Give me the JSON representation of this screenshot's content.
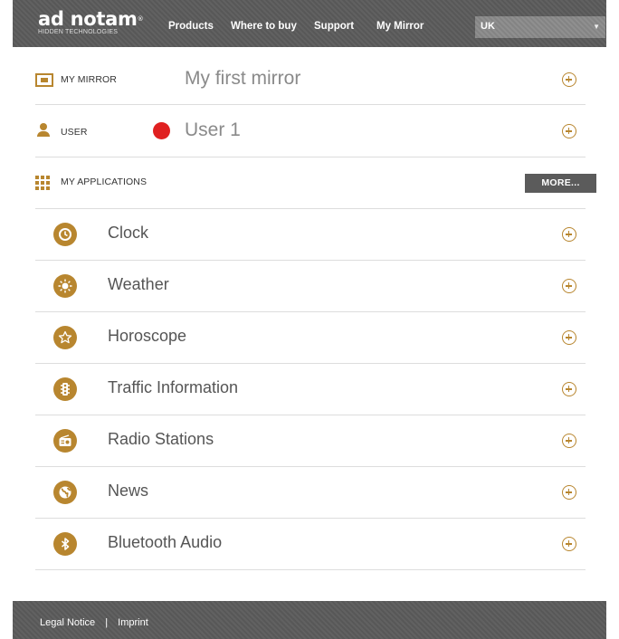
{
  "brand": {
    "name": "ad notam",
    "tagline": "HIDDEN TECHNOLOGIES",
    "mark": "®"
  },
  "nav": {
    "products": "Products",
    "where_to_buy": "Where to buy",
    "support": "Support",
    "my_mirror": "My Mirror"
  },
  "country": {
    "selected": "UK"
  },
  "mirror": {
    "label": "MY MIRROR",
    "value": "My first mirror"
  },
  "user": {
    "label": "USER",
    "value": "User 1",
    "color": "#e02020"
  },
  "apps": {
    "label": "MY APPLICATIONS",
    "more_label": "MORE...",
    "items": [
      {
        "label": "Clock",
        "icon": "clock-icon"
      },
      {
        "label": "Weather",
        "icon": "sun-icon"
      },
      {
        "label": "Horoscope",
        "icon": "star-icon"
      },
      {
        "label": "Traffic Information",
        "icon": "traffic-light-icon"
      },
      {
        "label": "Radio Stations",
        "icon": "radio-icon"
      },
      {
        "label": "News",
        "icon": "globe-icon"
      },
      {
        "label": "Bluetooth Audio",
        "icon": "bluetooth-icon"
      }
    ]
  },
  "footer": {
    "legal": "Legal Notice",
    "separator": "|",
    "imprint": "Imprint"
  },
  "colors": {
    "accent": "#b8862f",
    "header": "#5b5b5b"
  }
}
